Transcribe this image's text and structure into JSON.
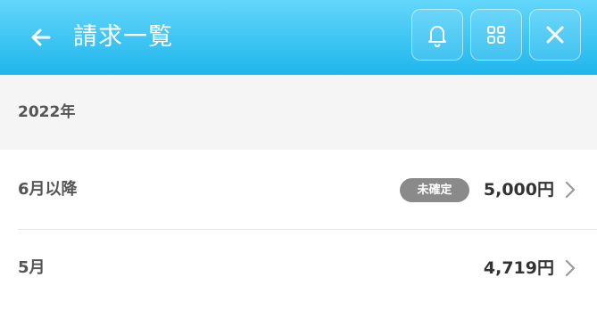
{
  "header": {
    "title": "請求一覧",
    "icons": [
      "arrow-left-icon",
      "bell-icon",
      "grid-icon",
      "close-icon"
    ],
    "gradient_top": "#63d6fb",
    "gradient_bottom": "#1fb6ec"
  },
  "year_section": {
    "label": "2022年"
  },
  "rows": [
    {
      "period": "6月以降",
      "badge": "未確定",
      "amount": "5,000円"
    },
    {
      "period": "5月",
      "amount": "4,719円"
    }
  ]
}
